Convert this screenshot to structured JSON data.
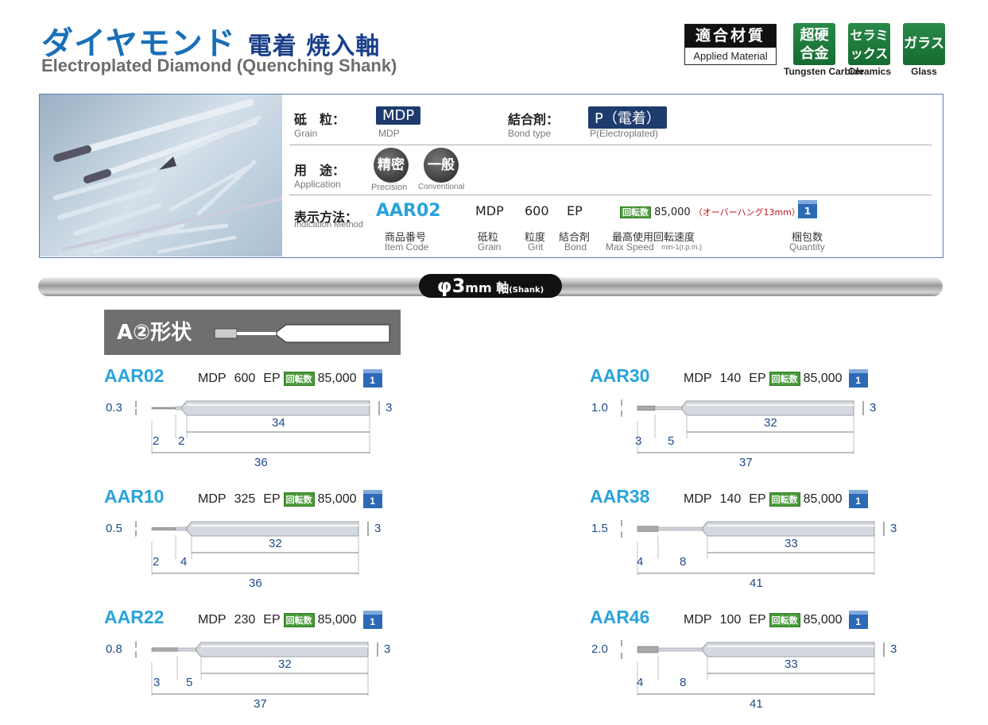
{
  "header": {
    "title_jp_main": "ダイヤモンド",
    "title_jp_sub": "電着 焼入軸",
    "title_en": "Electroplated Diamond (Quenching Shank)"
  },
  "materials": {
    "box_jp": "適合材質",
    "box_en": "Applied Material",
    "items": [
      {
        "jp": "超硬合金",
        "en": "Tungsten Carbide"
      },
      {
        "jp": "セラミックス",
        "en": "Ceramics"
      },
      {
        "jp": "ガラス",
        "en": "Glass"
      }
    ]
  },
  "specs": {
    "grain_jp": "砥　粒：",
    "grain_en": "Grain",
    "grain_val": "MDP",
    "grain_val_en": "MDP",
    "bond_jp": "結合剤：",
    "bond_en": "Bond type",
    "bond_val": "P（電着）",
    "bond_val_en": "P(Electroplated)",
    "app_jp": "用　途：",
    "app_en": "Application",
    "app1": "精密",
    "app1_en": "Precision",
    "app2": "一般",
    "app2_en": "Conventional",
    "ind_jp": "表示方法：",
    "ind_en": "Indication Method",
    "ind_code": "AAR02",
    "ind_code_jp": "商品番号",
    "ind_code_en": "Item Code",
    "ind_grain": "MDP",
    "ind_grain_jp": "砥粒",
    "ind_grain_en": "Grain",
    "ind_grit": "600",
    "ind_grit_jp": "粒度",
    "ind_grit_en": "Grit",
    "ind_bond": "EP",
    "ind_bond_jp": "結合剤",
    "ind_bond_en": "Bond",
    "rpm_tag": "回転数",
    "ind_speed": "85,000",
    "ind_overhang": "（オーバーハング13mm）",
    "ind_speed_jp": "最高使用回転速度",
    "ind_speed_en": "Max Speed",
    "ind_speed_unit": "min-1(r.p.m.)",
    "ind_qty": "1",
    "ind_qty_jp": "梱包数",
    "ind_qty_en": "Quantity"
  },
  "shank": {
    "phi": "φ3",
    "unit": "mm",
    "jp": "軸",
    "en": "(Shank)"
  },
  "shape": {
    "label": "A②形状"
  },
  "products": [
    {
      "code": "AAR02",
      "grain": "MDP",
      "grit": "600",
      "bond": "EP",
      "rpm_tag": "回転数",
      "speed": "85,000",
      "qty": "1",
      "dims": {
        "tip": "0.3",
        "shank": "3",
        "a": "2",
        "b": "2",
        "c": "34",
        "total": "36"
      }
    },
    {
      "code": "AAR10",
      "grain": "MDP",
      "grit": "325",
      "bond": "EP",
      "rpm_tag": "回転数",
      "speed": "85,000",
      "qty": "1",
      "dims": {
        "tip": "0.5",
        "shank": "3",
        "a": "2",
        "b": "4",
        "c": "32",
        "total": "36"
      }
    },
    {
      "code": "AAR22",
      "grain": "MDP",
      "grit": "230",
      "bond": "EP",
      "rpm_tag": "回転数",
      "speed": "85,000",
      "qty": "1",
      "dims": {
        "tip": "0.8",
        "shank": "3",
        "a": "3",
        "b": "5",
        "c": "32",
        "total": "37"
      }
    },
    {
      "code": "AAR30",
      "grain": "MDP",
      "grit": "140",
      "bond": "EP",
      "rpm_tag": "回転数",
      "speed": "85,000",
      "qty": "1",
      "dims": {
        "tip": "1.0",
        "shank": "3",
        "a": "3",
        "b": "5",
        "c": "32",
        "total": "37"
      }
    },
    {
      "code": "AAR38",
      "grain": "MDP",
      "grit": "140",
      "bond": "EP",
      "rpm_tag": "回転数",
      "speed": "85,000",
      "qty": "1",
      "dims": {
        "tip": "1.5",
        "shank": "3",
        "a": "4",
        "b": "8",
        "c": "33",
        "total": "41"
      }
    },
    {
      "code": "AAR46",
      "grain": "MDP",
      "grit": "100",
      "bond": "EP",
      "rpm_tag": "回転数",
      "speed": "85,000",
      "qty": "1",
      "dims": {
        "tip": "2.0",
        "shank": "3",
        "a": "4",
        "b": "8",
        "c": "33",
        "total": "41"
      }
    }
  ]
}
